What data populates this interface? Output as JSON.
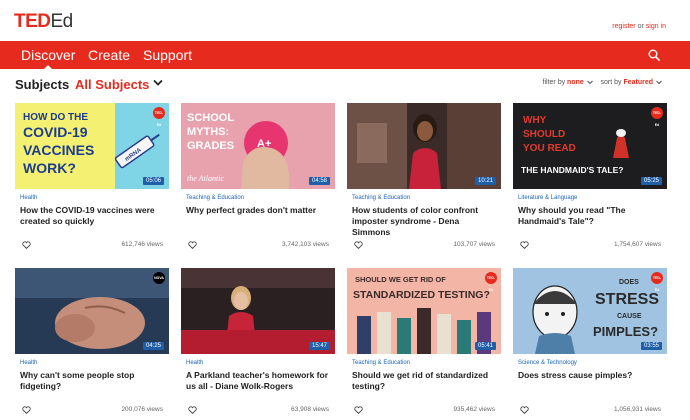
{
  "header": {
    "logo_ted": "TED",
    "logo_ed": "Ed",
    "register": "register",
    "or": "or",
    "sign_in": "sign in"
  },
  "nav": {
    "items": [
      {
        "label": "Discover"
      },
      {
        "label": "Create"
      },
      {
        "label": "Support"
      }
    ],
    "search_icon": "search-icon"
  },
  "subjects": {
    "label": "Subjects",
    "value": "All Subjects",
    "filter_label": "filter by",
    "filter_value": "none",
    "sort_label": "sort by",
    "sort_value": "Featured"
  },
  "cards": [
    {
      "category": "Health",
      "title": "How the COVID-19 vaccines were created so quickly",
      "views": "612,746 views",
      "duration": "05:06",
      "badge": "TED-Ed",
      "thumb_text": [
        "HOW DO THE",
        "COVID-19",
        "VACCINES",
        "WORK?"
      ],
      "thumb_icon_text": "mRNA"
    },
    {
      "category": "Teaching & Education",
      "title": "Why perfect grades don't matter",
      "views": "3,742,103 views",
      "duration": "04:58",
      "thumb_text": [
        "SCHOOL",
        "MYTHS:",
        "GRADES"
      ],
      "thumb_mark": "the Atlantic",
      "thumb_ball": "A+"
    },
    {
      "category": "Teaching & Education",
      "title": "How students of color confront imposter syndrome - Dena Simmons",
      "views": "103,707 views",
      "duration": "10:21"
    },
    {
      "category": "Literature & Language",
      "title": "Why should you read \"The Handmaid's Tale\"?",
      "views": "1,754,607 views",
      "duration": "05:25",
      "badge": "TED-Ed",
      "thumb_text": [
        "WHY",
        "SHOULD",
        "YOU READ",
        "THE HANDMAID'S TALE?"
      ]
    },
    {
      "category": "Health",
      "title": "Why can't some people stop fidgeting?",
      "views": "200,076 views",
      "duration": "04:25",
      "badge": "NOVA"
    },
    {
      "category": "Health",
      "title": "A Parkland teacher's homework for us all - Diane Wolk-Rogers",
      "views": "63,908 views",
      "duration": "15:47"
    },
    {
      "category": "Teaching & Education",
      "title": "Should we get rid of standardized testing?",
      "views": "935,462 views",
      "duration": "05:41",
      "badge": "TED-Ed",
      "thumb_text": [
        "SHOULD WE GET RID OF",
        "STANDARDIZED TESTING?"
      ]
    },
    {
      "category": "Science & Technology",
      "title": "Does stress cause pimples?",
      "views": "1,056,931 views",
      "duration": "03:55",
      "badge": "TED-Ed",
      "thumb_text": [
        "DOES",
        "STRESS",
        "CAUSE",
        "PIMPLES?"
      ]
    }
  ],
  "colors": {
    "accent": "#e62b1e",
    "link": "#1a65b5",
    "duration_bg": "#1f5fa8"
  }
}
